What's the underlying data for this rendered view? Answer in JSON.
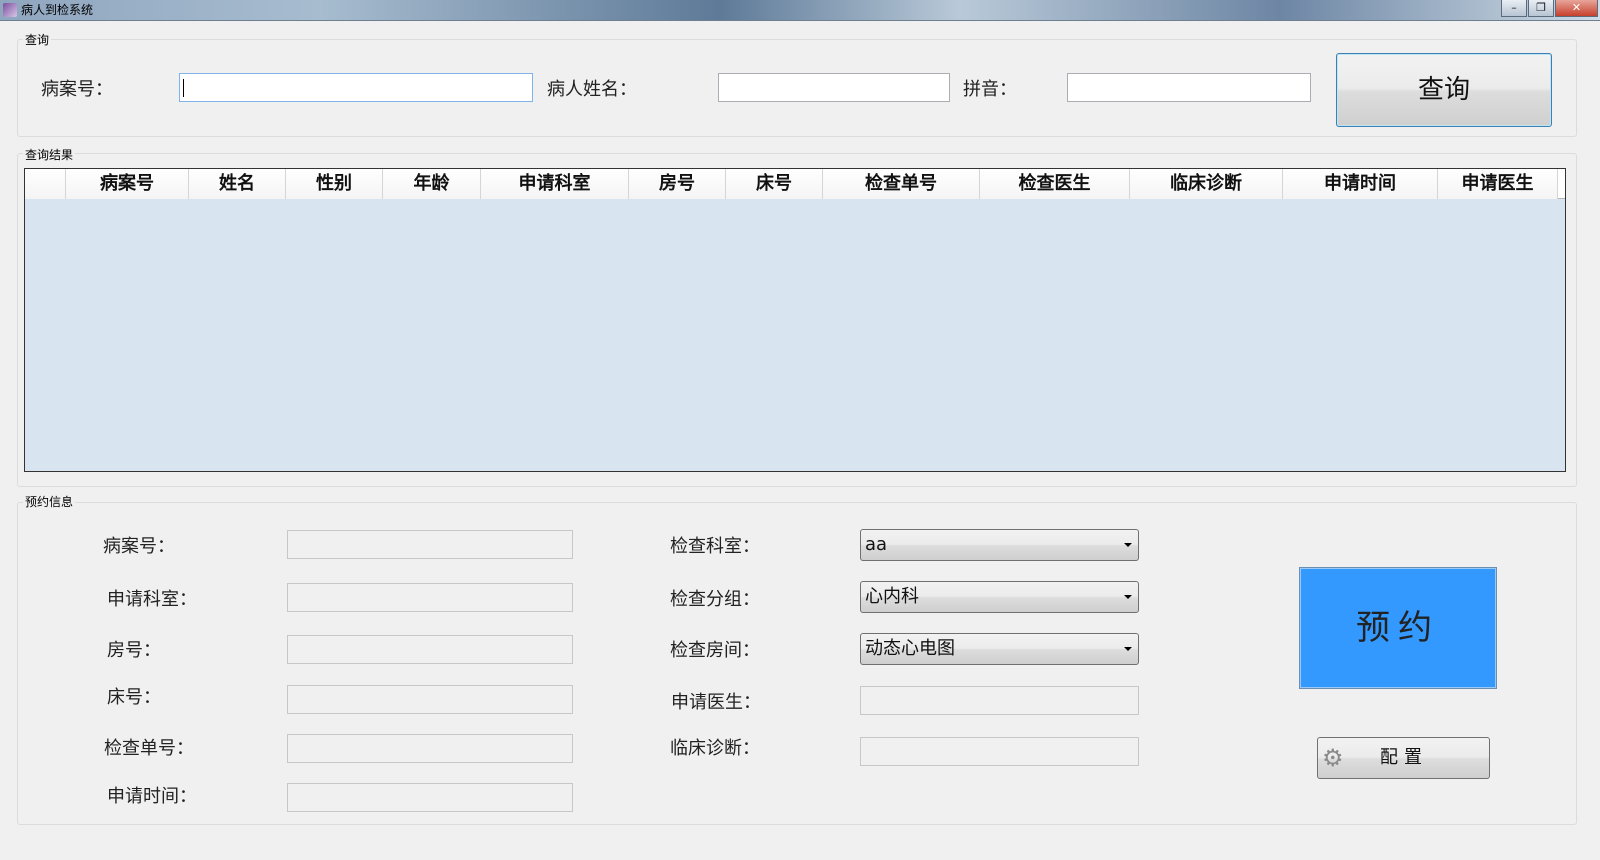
{
  "window": {
    "title": "病人到检系统",
    "minimize": "–",
    "maximize": "❐",
    "close": "✕"
  },
  "query_group": {
    "label": "查询",
    "case_no_label": "病案号：",
    "case_no_value": "",
    "name_label": "病人姓名：",
    "name_value": "",
    "pinyin_label": "拼音：",
    "pinyin_value": "",
    "query_button": "查询"
  },
  "results_group": {
    "label": "查询结果",
    "columns": [
      "病案号",
      "姓名",
      "性别",
      "年龄",
      "申请科室",
      "房号",
      "床号",
      "检查单号",
      "检查医生",
      "临床诊断",
      "申请时间",
      "申请医生"
    ],
    "rows": []
  },
  "booking_group": {
    "label": "预约信息",
    "case_no_label": "病案号：",
    "dept_label": "申请科室：",
    "room_label": "房号：",
    "bed_label": "床号：",
    "exam_no_label": "检查单号：",
    "apply_time_label": "申请时间：",
    "exam_dept_label": "检查科室：",
    "exam_dept_value": "aa",
    "exam_group_label": "检查分组：",
    "exam_group_value": "心内科",
    "exam_room_label": "检查房间：",
    "exam_room_value": "动态心电图",
    "apply_doctor_label": "申请医生：",
    "diagnosis_label": "临床诊断：",
    "book_button": "预约",
    "config_button": "配置",
    "book_button_color": "#3399ff"
  }
}
